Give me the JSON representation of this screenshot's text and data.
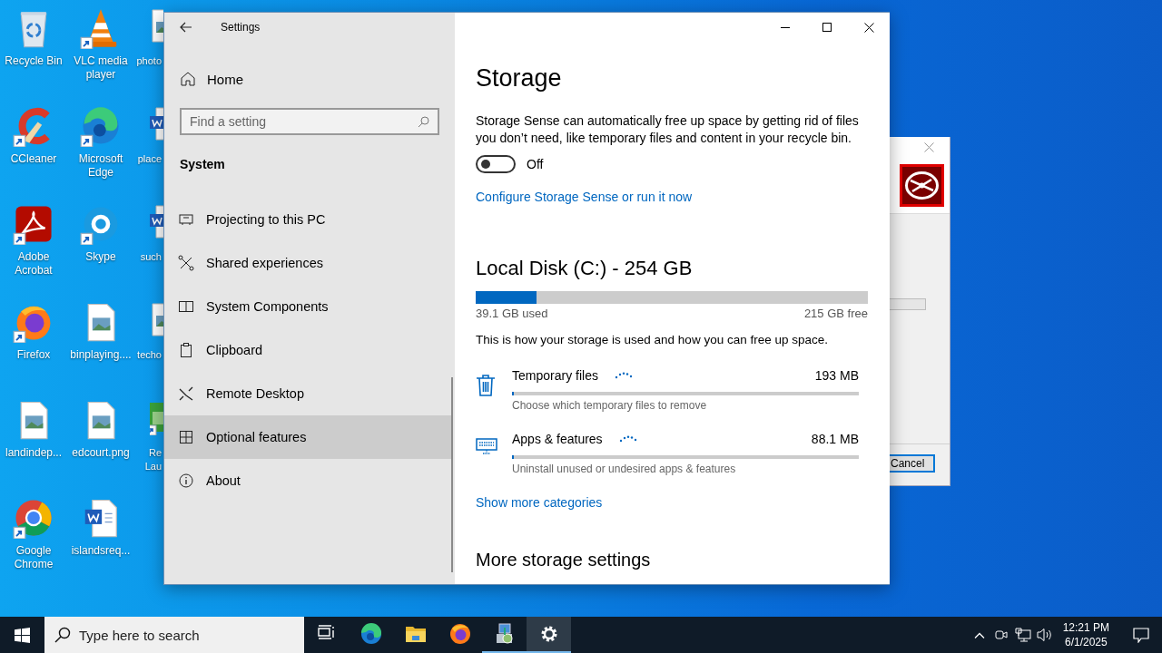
{
  "desktop": {
    "columns": [
      {
        "icons": [
          {
            "label": "Recycle Bin",
            "kind": "recycle",
            "shortcut": false
          },
          {
            "label": "CCleaner",
            "kind": "ccleaner",
            "shortcut": true
          },
          {
            "label": "Adobe Acrobat",
            "kind": "acrobat",
            "shortcut": true
          },
          {
            "label": "Firefox",
            "kind": "firefox",
            "shortcut": true
          },
          {
            "label": "landindep...",
            "kind": "image",
            "shortcut": false
          },
          {
            "label": "Google Chrome",
            "kind": "chrome",
            "shortcut": true
          }
        ]
      },
      {
        "icons": [
          {
            "label": "VLC media player",
            "kind": "vlc",
            "shortcut": true
          },
          {
            "label": "Microsoft Edge",
            "kind": "edge",
            "shortcut": true
          },
          {
            "label": "Skype",
            "kind": "skype",
            "shortcut": true
          },
          {
            "label": "binplaying....",
            "kind": "image",
            "shortcut": false
          },
          {
            "label": "edcourt.png",
            "kind": "image",
            "shortcut": false
          },
          {
            "label": "islandsreq...",
            "kind": "word",
            "shortcut": false
          }
        ]
      },
      {
        "icons": [
          {
            "label": "photo",
            "kind": "image",
            "shortcut": false
          },
          {
            "label": "place",
            "kind": "word",
            "shortcut": false
          },
          {
            "label": "such",
            "kind": "word",
            "shortcut": false
          },
          {
            "label": "techo",
            "kind": "image",
            "shortcut": false
          },
          {
            "label": "Re Lau",
            "kind": "app",
            "shortcut": true
          }
        ]
      }
    ]
  },
  "dialog": {
    "progress": {
      "level": 0
    },
    "button": "Cancel"
  },
  "settings": {
    "title": "Settings",
    "sidebar": {
      "home": "Home",
      "search_placeholder": "Find a setting",
      "section": "System",
      "items": [
        {
          "label": "Projecting to this PC",
          "kind": "projector",
          "selected": false
        },
        {
          "label": "Shared experiences",
          "kind": "share",
          "selected": false
        },
        {
          "label": "System Components",
          "kind": "components",
          "selected": false
        },
        {
          "label": "Clipboard",
          "kind": "clipboard",
          "selected": false
        },
        {
          "label": "Remote Desktop",
          "kind": "remote",
          "selected": false
        },
        {
          "label": "Optional features",
          "kind": "optional",
          "selected": true
        },
        {
          "label": "About",
          "kind": "about",
          "selected": false
        }
      ]
    },
    "content": {
      "title": "Storage",
      "description": "Storage Sense can automatically free up space by getting rid of files you don’t need, like temporary files and content in your recycle bin.",
      "storage_sense": {
        "on": false,
        "label": "Off"
      },
      "configure_link": "Configure Storage Sense or run it now",
      "disk": {
        "title": "Local Disk (C:) - 254 GB",
        "level": 0.155,
        "used": "39.1 GB used",
        "free": "215 GB free"
      },
      "usage_note": "This is how your storage is used and how you can free up space.",
      "categories": [
        {
          "name": "Temporary files",
          "kind": "trash",
          "loading": true,
          "size": "193 MB",
          "level": 0.005,
          "description": "Choose which temporary files to remove"
        },
        {
          "name": "Apps & features",
          "kind": "apps",
          "loading": true,
          "size": "88.1 MB",
          "level": 0.005,
          "description": "Uninstall unused or undesired apps & features"
        }
      ],
      "more_link": "Show more categories",
      "more_heading": "More storage settings"
    }
  },
  "taskbar": {
    "search_placeholder": "Type here to search",
    "apps": [
      {
        "kind": "taskview",
        "running": false,
        "selected": false
      },
      {
        "kind": "edge",
        "running": false,
        "selected": false
      },
      {
        "kind": "explorer",
        "running": false,
        "selected": false
      },
      {
        "kind": "firefox",
        "running": false,
        "selected": false
      },
      {
        "kind": "installer",
        "running": true,
        "selected": false
      },
      {
        "kind": "settings",
        "running": true,
        "selected": true
      }
    ],
    "time": "12:21 PM",
    "date": "6/1/2025"
  }
}
